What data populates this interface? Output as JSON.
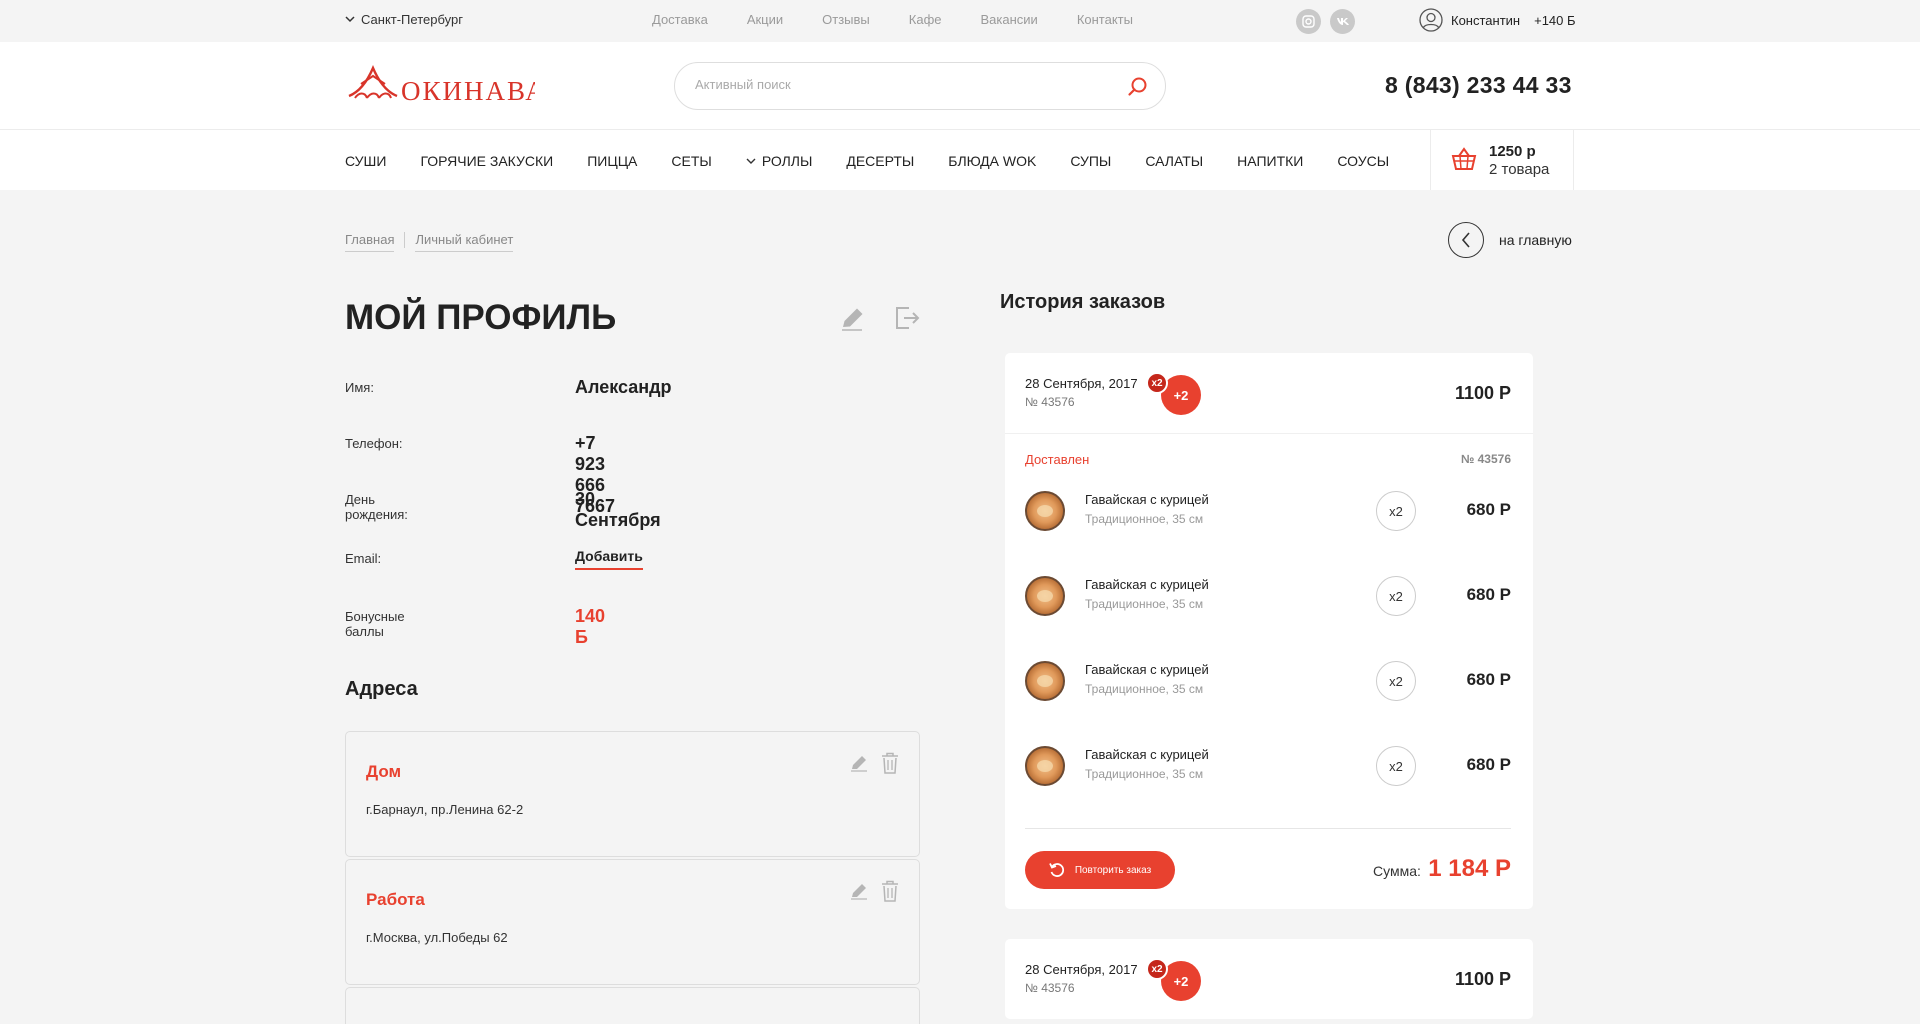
{
  "topbar": {
    "city": "Санкт-Петербург",
    "nav": [
      "Доставка",
      "Акции",
      "Отзывы",
      "Кафе",
      "Вакансии",
      "Контакты"
    ],
    "social": [
      "instagram-icon",
      "vk-icon"
    ],
    "user_name": "Константин",
    "user_bonus": "+140 Б"
  },
  "header": {
    "logo_text": "ОКИНАВА",
    "search_placeholder": "Активный поиск",
    "phone": "8 (843) 233 44 33"
  },
  "menu": {
    "items": [
      "Суши",
      "Горячие закуски",
      "Пицца",
      "Сеты",
      "Роллы",
      "Десерты",
      "Блюда WOK",
      "Супы",
      "Салаты",
      "Напитки",
      "Соусы"
    ]
  },
  "cart": {
    "sum": "1250 р",
    "count": "2 товара"
  },
  "breadcrumbs": {
    "home": "Главная",
    "current": "Личный кабинет",
    "back": "на главную"
  },
  "profile": {
    "title": "МОЙ ПРОФИЛЬ",
    "fields": [
      {
        "label": "Имя:",
        "value": "Александр"
      },
      {
        "label": "Телефон:",
        "value": "+7 923 666 7667"
      },
      {
        "label": "День рождения:",
        "value": "30 Сентября"
      },
      {
        "label": "Email:",
        "value": "Добавить"
      },
      {
        "label": "Бонусные баллы",
        "value": "140 Б"
      }
    ]
  },
  "addresses": {
    "title": "Адреса",
    "items": [
      {
        "name": "Дом",
        "text": "г.Барнаул, пр.Ленина 62-2"
      },
      {
        "name": "Работа",
        "text": "г.Москва, ул.Победы 62"
      }
    ]
  },
  "orders": {
    "title": "История заказов",
    "list": [
      {
        "date": "28 Сентября, 2017",
        "number": "№ 43576",
        "badge_x": "x2",
        "badge_plus": "+2",
        "price": "1100 Р",
        "status": "Доставлен",
        "items": [
          {
            "name": "Гавайская с курицей",
            "sub": "Традиционное, 35 см",
            "qty": "x2",
            "price": "680 Р"
          },
          {
            "name": "Гавайская с курицей",
            "sub": "Традиционное, 35 см",
            "qty": "x2",
            "price": "680 Р"
          },
          {
            "name": "Гавайская с курицей",
            "sub": "Традиционное, 35 см",
            "qty": "x2",
            "price": "680 Р"
          },
          {
            "name": "Гавайская с курицей",
            "sub": "Традиционное, 35 см",
            "qty": "x2",
            "price": "680 Р"
          }
        ],
        "repeat_label": "Повторить заказ",
        "sum_label": "Сумма:",
        "sum": "1 184 Р"
      },
      {
        "date": "28 Сентября, 2017",
        "number": "№ 43576",
        "badge_x": "x2",
        "badge_plus": "+2",
        "price": "1100 Р"
      }
    ]
  },
  "colors": {
    "accent": "#e8412f",
    "background": "#f4f4f4",
    "text": "#222222"
  }
}
